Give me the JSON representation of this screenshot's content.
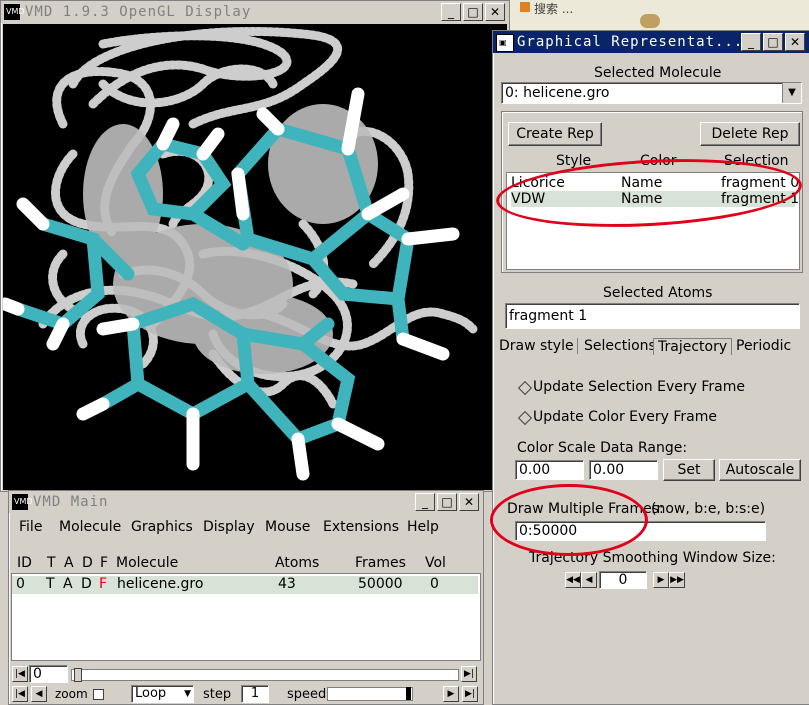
{
  "display_window": {
    "title": "VMD 1.9.3 OpenGL Display",
    "controls": [
      "_",
      "□",
      "✕"
    ]
  },
  "main_window": {
    "title": "VMD Main",
    "controls": [
      "_",
      "□",
      "✕"
    ],
    "menu": [
      "File",
      "Molecule",
      "Graphics",
      "Display",
      "Mouse",
      "Extensions",
      "Help"
    ],
    "columns": [
      "ID",
      "T",
      "A",
      "D",
      "F",
      "Molecule",
      "Atoms",
      "Frames",
      "Vol"
    ],
    "rows": [
      {
        "id": "0",
        "t": "T",
        "a": "A",
        "d": "D",
        "f": "F",
        "molecule": "helicene.gro",
        "atoms": "43",
        "frames": "50000",
        "vol": "0"
      }
    ],
    "frame_value": "0",
    "zoom_label": "zoom",
    "loop_value": "Loop",
    "step_label": "step",
    "step_value": "1",
    "speed_label": "speed"
  },
  "graph_rep_window": {
    "title": "Graphical Representat...",
    "controls": [
      "_",
      "□",
      "✕"
    ],
    "selected_molecule_label": "Selected Molecule",
    "selected_molecule_value": "0: helicene.gro",
    "create_rep": "Create Rep",
    "delete_rep": "Delete Rep",
    "rep_columns": [
      "Style",
      "Color",
      "Selection"
    ],
    "reps": [
      {
        "style": "Licorice",
        "color": "Name",
        "selection": "fragment 0"
      },
      {
        "style": "VDW",
        "color": "Name",
        "selection": "fragment 1"
      }
    ],
    "selected_atoms_label": "Selected Atoms",
    "selected_atoms_value": "fragment 1",
    "tabs": [
      "Draw style",
      "Selections",
      "Trajectory",
      "Periodic"
    ],
    "update_selection": "Update Selection Every Frame",
    "update_color": "Update Color Every Frame",
    "color_scale_label": "Color Scale Data Range:",
    "range_min": "0.00",
    "range_max": "0.00",
    "set_button": "Set",
    "autoscale_button": "Autoscale",
    "draw_multiple_label": "Draw Multiple Frames:",
    "draw_multiple_hint": "(now, b:e, b:s:e)",
    "draw_multiple_value": "0:50000",
    "smoothing_label": "Trajectory Smoothing Window Size:",
    "smoothing_value": "0"
  },
  "background_window": {
    "partial_text": "...",
    "partial_tab": "搜索 ..."
  },
  "colors": {
    "carbon": "#3fb4bc",
    "hydrogen": "#ffffff",
    "annotation": "#e0001a",
    "selection_row": "#d7e3d7"
  }
}
